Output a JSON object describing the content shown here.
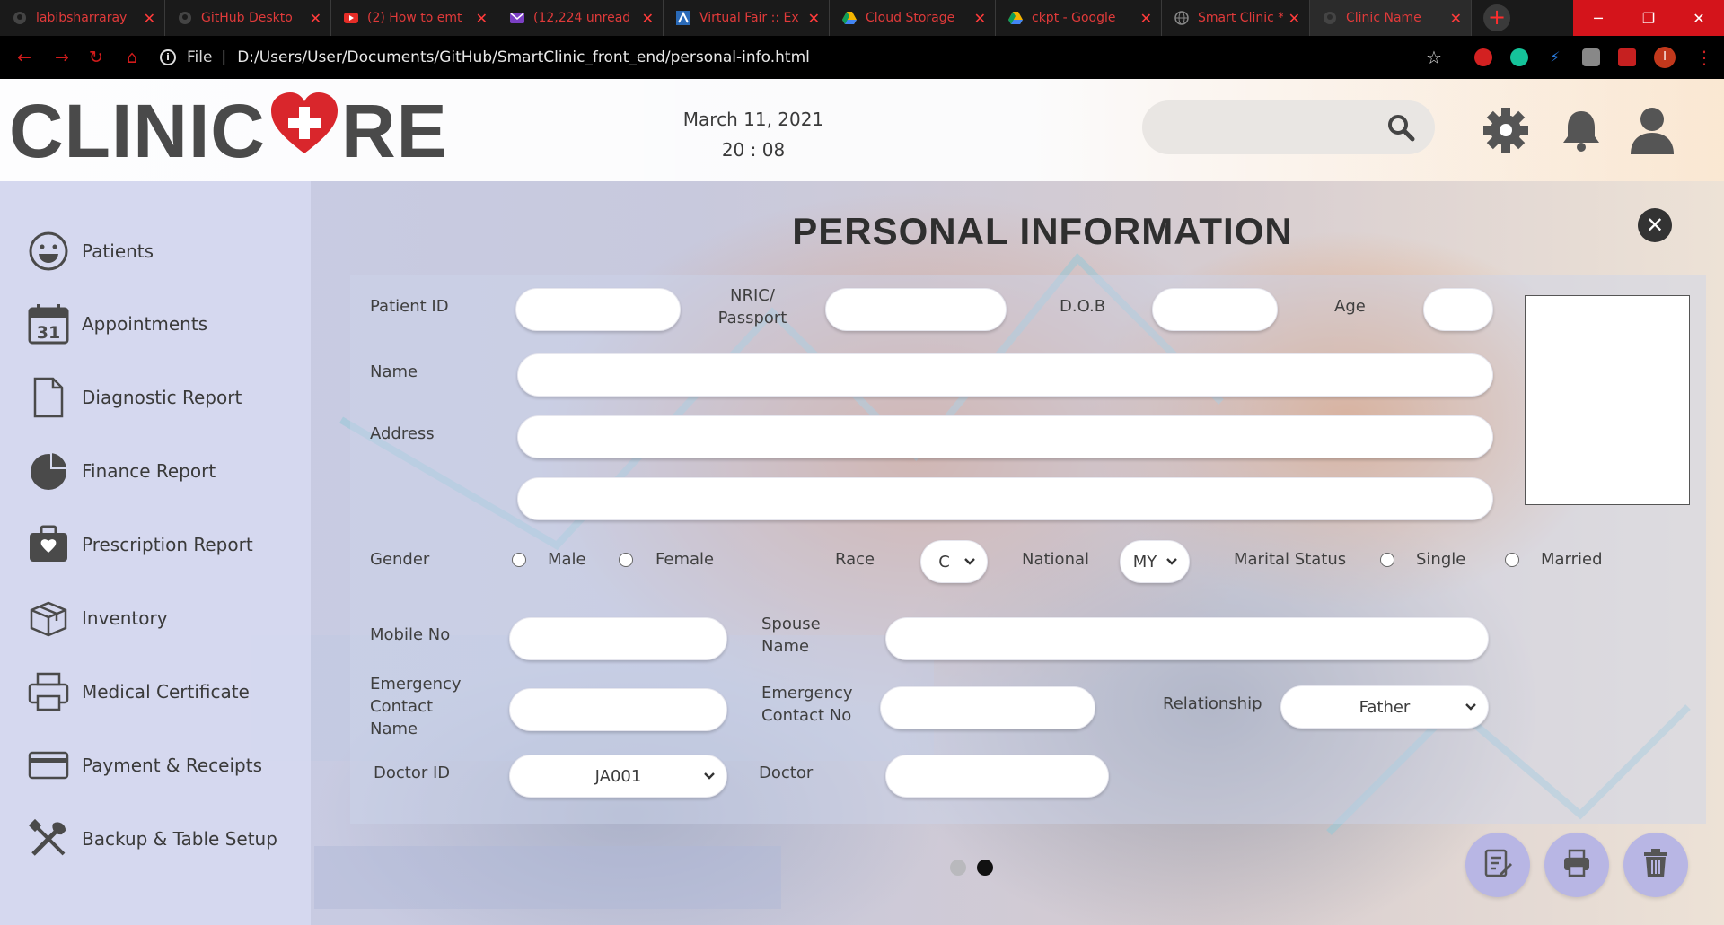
{
  "browser": {
    "tabs": [
      {
        "title": "labibsharraray",
        "icon": "github-icon"
      },
      {
        "title": "GitHub Deskto",
        "icon": "github-icon"
      },
      {
        "title": "(2) How to emt",
        "icon": "youtube-icon"
      },
      {
        "title": "(12,224 unread",
        "icon": "mail-icon"
      },
      {
        "title": "Virtual Fair :: Ex",
        "icon": "fair-icon"
      },
      {
        "title": "Cloud Storage",
        "icon": "drive-icon"
      },
      {
        "title": "ckpt - Google",
        "icon": "drive-icon"
      },
      {
        "title": "Smart Clinic *C",
        "icon": "globe-icon"
      },
      {
        "title": "Clinic Name",
        "icon": "github-icon"
      }
    ],
    "url_scheme": "File",
    "url": "D:/Users/User/Documents/GitHub/SmartClinic_front_end/personal-info.html",
    "profile_initial": "I"
  },
  "header": {
    "logo_left": "CLINIC",
    "logo_right": "RE",
    "date": "March 11, 2021",
    "time": "20 : 08",
    "search_placeholder": ""
  },
  "sidebar": {
    "items": [
      {
        "label": "Patients",
        "icon": "smiley-icon"
      },
      {
        "label": "Appointments",
        "icon": "calendar-icon"
      },
      {
        "label": "Diagnostic Report",
        "icon": "document-icon"
      },
      {
        "label": "Finance Report",
        "icon": "pie-chart-icon"
      },
      {
        "label": "Prescription Report",
        "icon": "medical-kit-icon"
      },
      {
        "label": "Inventory",
        "icon": "box-icon"
      },
      {
        "label": "Medical Certificate",
        "icon": "printer-icon"
      },
      {
        "label": "Payment & Receipts",
        "icon": "credit-card-icon"
      },
      {
        "label": "Backup & Table Setup",
        "icon": "tools-icon"
      }
    ]
  },
  "form": {
    "title": "PERSONAL INFORMATION",
    "labels": {
      "patient_id": "Patient ID",
      "nric_1": "NRIC/",
      "nric_2": "Passport",
      "dob": "D.O.B",
      "age": "Age",
      "name": "Name",
      "address": "Address",
      "gender": "Gender",
      "male": "Male",
      "female": "Female",
      "race": "Race",
      "national": "National",
      "marital_status": "Marital Status",
      "single": "Single",
      "married": "Married",
      "mobile_no": "Mobile No",
      "spouse_1": "Spouse",
      "spouse_2": "Name",
      "emergency_name_1": "Emergency",
      "emergency_name_2": "Contact",
      "emergency_name_3": "Name",
      "emergency_no_1": "Emergency",
      "emergency_no_2": "Contact No",
      "relationship": "Relationship",
      "doctor_id": "Doctor ID",
      "doctor": "Doctor"
    },
    "values": {
      "race": "C",
      "national": "MY",
      "relationship": "Father",
      "doctor_id": "JA001"
    },
    "pager": {
      "total": 2,
      "active": 2
    }
  },
  "actions": [
    {
      "name": "edit-button",
      "icon": "edit-note-icon"
    },
    {
      "name": "print-button",
      "icon": "printer-icon"
    },
    {
      "name": "delete-button",
      "icon": "trash-icon"
    }
  ],
  "colors": {
    "chrome_accent": "#d4141b",
    "heart": "#d9262c",
    "fab": "#b8b6e4",
    "text": "#3a3a3a"
  }
}
